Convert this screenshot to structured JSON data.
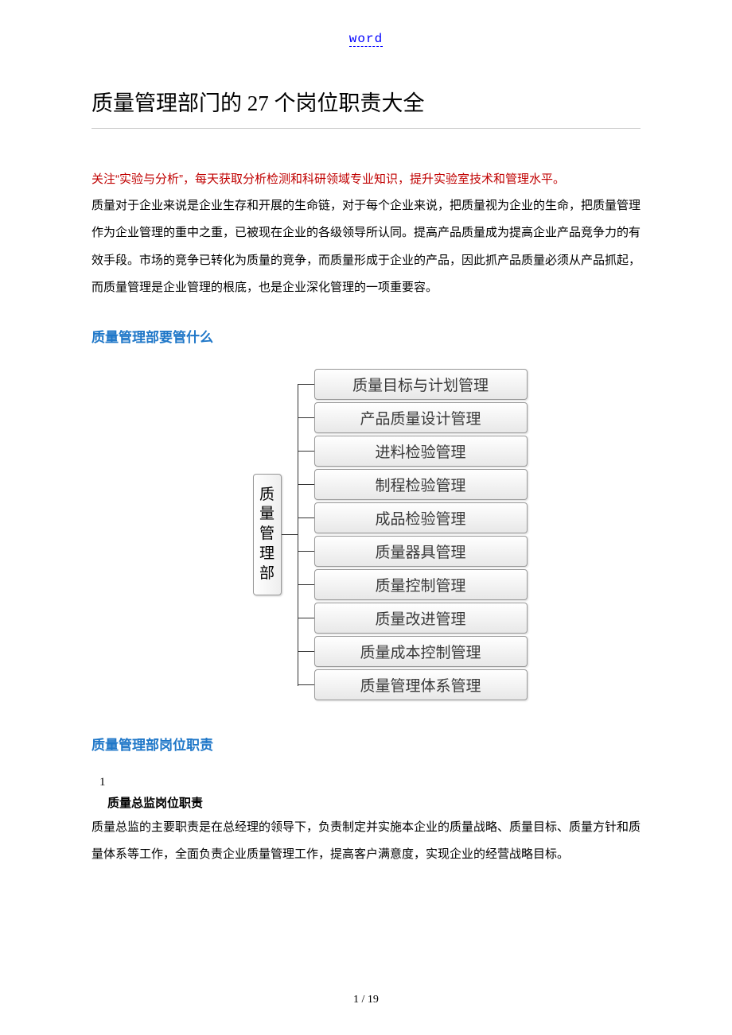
{
  "header": {
    "link": "word"
  },
  "title": "质量管理部门的 27 个岗位职责大全",
  "intro": {
    "red": "关注“实验与分析”，每天获取分析检测和科研领域专业知识，提升实验室技术和管理水平。",
    "body": "质量对于企业来说是企业生存和开展的生命链，对于每个企业来说，把质量视为企业的生命，把质量管理作为企业管理的重中之重，已被现在企业的各级领导所认同。提高产品质量成为提高企业产品竞争力的有效手段。市场的竞争已转化为质量的竞争，而质量形成于企业的产品，因此抓产品质量必须从产品抓起，而质量管理是企业管理的根底，也是企业深化管理的一项重要容。"
  },
  "section1": {
    "heading": "质量管理部要管什么",
    "root": "质量管理部",
    "leaves": [
      "质量目标与计划管理",
      "产品质量设计管理",
      "进料检验管理",
      "制程检验管理",
      "成品检验管理",
      "质量器具管理",
      "质量控制管理",
      "质量改进管理",
      "质量成本控制管理",
      "质量管理体系管理"
    ]
  },
  "section2": {
    "heading": "质量管理部岗位职责",
    "num": "1",
    "sub": "质量总监岗位职责",
    "body": "质量总监的主要职责是在总经理的领导下，负责制定并实施本企业的质量战略、质量目标、质量方针和质量体系等工作，全面负责企业质量管理工作，提高客户满意度，实现企业的经营战略目标。"
  },
  "footer": {
    "page": "1 / 19"
  }
}
